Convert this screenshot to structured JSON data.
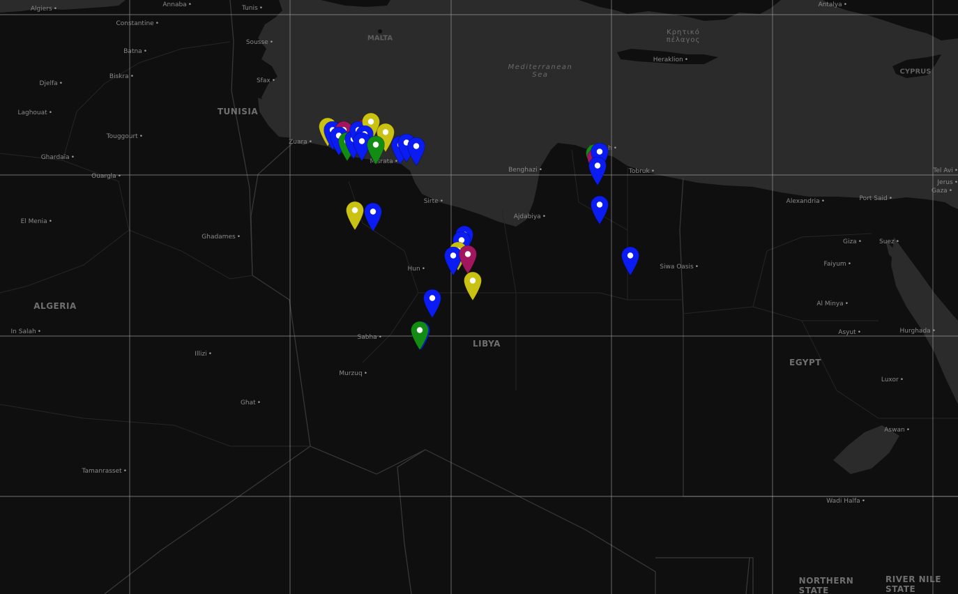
{
  "colors": {
    "land": "#0f0f0f",
    "sea": "#2b2b2b",
    "border": "#3a3a3a",
    "grid": "#bdbdbd",
    "marker_blue": "#0a1cf2",
    "marker_yellow": "#c9c213",
    "marker_green": "#138c13",
    "marker_magenta": "#a1165f",
    "marker_red": "#c41010"
  },
  "icons": {
    "marker": "map-pin-icon"
  },
  "labels": {
    "countries": [
      {
        "key": "tunisia",
        "text": "TUNISIA"
      },
      {
        "key": "algeria",
        "text": "ALGERIA"
      },
      {
        "key": "libya",
        "text": "LIBYA"
      },
      {
        "key": "egypt",
        "text": "EGYPT"
      },
      {
        "key": "cyprus",
        "text": "CYPRUS"
      },
      {
        "key": "northern-state",
        "text": "NORTHERN\nSTATE"
      },
      {
        "key": "river-nile-state",
        "text": "RIVER NILE\nSTATE"
      }
    ],
    "seas": [
      {
        "key": "mediterranean",
        "text": "Mediterranean\nSea"
      },
      {
        "key": "cretan",
        "text": "Κρητικό\nπέλαγος"
      },
      {
        "key": "malta",
        "text": "MALTA"
      }
    ],
    "cities": [
      {
        "key": "algiers",
        "text": "Algiers"
      },
      {
        "key": "annaba",
        "text": "Annaba"
      },
      {
        "key": "tunis",
        "text": "Tunis"
      },
      {
        "key": "constantine",
        "text": "Constantine"
      },
      {
        "key": "batna",
        "text": "Batna"
      },
      {
        "key": "sousse",
        "text": "Sousse"
      },
      {
        "key": "djelfa",
        "text": "Djelfa"
      },
      {
        "key": "biskra",
        "text": "Biskra"
      },
      {
        "key": "sfax",
        "text": "Sfax"
      },
      {
        "key": "laghouat",
        "text": "Laghouat"
      },
      {
        "key": "touggourt",
        "text": "Touggourt"
      },
      {
        "key": "ghardaia",
        "text": "Ghardaïa"
      },
      {
        "key": "ouargla",
        "text": "Ouargla"
      },
      {
        "key": "zuara",
        "text": "Zuara"
      },
      {
        "key": "misrata",
        "text": "Misrata"
      },
      {
        "key": "el-menia",
        "text": "El Menia"
      },
      {
        "key": "ghadames",
        "text": "Ghadames"
      },
      {
        "key": "sirte",
        "text": "Sirte"
      },
      {
        "key": "hun",
        "text": "Hun"
      },
      {
        "key": "in-salah",
        "text": "In Salah"
      },
      {
        "key": "sabha",
        "text": "Sabha"
      },
      {
        "key": "illizi",
        "text": "Illizi"
      },
      {
        "key": "murzuq",
        "text": "Murzuq"
      },
      {
        "key": "ghat",
        "text": "Ghat"
      },
      {
        "key": "tamanrasset",
        "text": "Tamanrasset"
      },
      {
        "key": "benghazi",
        "text": "Benghazi"
      },
      {
        "key": "ajdabiya",
        "text": "Ajdabiya"
      },
      {
        "key": "darnah",
        "text": "Darnah"
      },
      {
        "key": "tobruk",
        "text": "Tobruk"
      },
      {
        "key": "heraklion",
        "text": "Heraklion"
      },
      {
        "key": "antalya",
        "text": "Antalya"
      },
      {
        "key": "alexandria",
        "text": "Alexandria"
      },
      {
        "key": "port-said",
        "text": "Port Said"
      },
      {
        "key": "giza",
        "text": "Giza"
      },
      {
        "key": "suez",
        "text": "Suez"
      },
      {
        "key": "faiyum",
        "text": "Faiyum"
      },
      {
        "key": "siwa-oasis",
        "text": "Siwa Oasis"
      },
      {
        "key": "al-minya",
        "text": "Al Minya"
      },
      {
        "key": "asyut",
        "text": "Asyut"
      },
      {
        "key": "hurghada",
        "text": "Hurghada"
      },
      {
        "key": "luxor",
        "text": "Luxor"
      },
      {
        "key": "aswan",
        "text": "Aswan"
      },
      {
        "key": "wadi-halfa",
        "text": "Wadi Halfa"
      },
      {
        "key": "tel-aviv",
        "text": "Tel Avi"
      },
      {
        "key": "jerusalem",
        "text": "Jerus"
      },
      {
        "key": "gaza",
        "text": "Gaza"
      }
    ]
  },
  "markers": [
    {
      "color": "yellow",
      "lon": 11.6,
      "lat": 32.95
    },
    {
      "color": "blue",
      "lon": 11.75,
      "lat": 32.85
    },
    {
      "color": "magenta",
      "lon": 12.1,
      "lat": 32.85
    },
    {
      "color": "blue",
      "lon": 11.95,
      "lat": 32.7
    },
    {
      "color": "green",
      "lon": 12.2,
      "lat": 32.55
    },
    {
      "color": "blue",
      "lon": 12.4,
      "lat": 32.6
    },
    {
      "color": "red",
      "lon": 12.7,
      "lat": 32.9
    },
    {
      "color": "blue",
      "lon": 12.55,
      "lat": 32.85
    },
    {
      "color": "yellow",
      "lon": 12.95,
      "lat": 33.1
    },
    {
      "color": "blue",
      "lon": 12.75,
      "lat": 32.75
    },
    {
      "color": "blue",
      "lon": 12.65,
      "lat": 32.55
    },
    {
      "color": "yellow",
      "lon": 13.4,
      "lat": 32.8
    },
    {
      "color": "green",
      "lon": 13.1,
      "lat": 32.45
    },
    {
      "color": "blue",
      "lon": 13.85,
      "lat": 32.45
    },
    {
      "color": "blue",
      "lon": 14.05,
      "lat": 32.5
    },
    {
      "color": "blue",
      "lon": 14.35,
      "lat": 32.4
    },
    {
      "color": "green",
      "lon": 19.9,
      "lat": 32.2
    },
    {
      "color": "magenta",
      "lon": 19.95,
      "lat": 32.1
    },
    {
      "color": "blue",
      "lon": 20.05,
      "lat": 32.25
    },
    {
      "color": "blue",
      "lon": 20.0,
      "lat": 31.85
    },
    {
      "color": "blue",
      "lon": 20.05,
      "lat": 30.75
    },
    {
      "color": "yellow",
      "lon": 12.45,
      "lat": 30.6
    },
    {
      "color": "blue",
      "lon": 13.0,
      "lat": 30.55
    },
    {
      "color": "blue",
      "lon": 15.85,
      "lat": 29.9
    },
    {
      "color": "blue",
      "lon": 15.75,
      "lat": 29.75
    },
    {
      "color": "yellow",
      "lon": 15.65,
      "lat": 29.45
    },
    {
      "color": "blue",
      "lon": 15.5,
      "lat": 29.3
    },
    {
      "color": "magenta",
      "lon": 15.95,
      "lat": 29.35
    },
    {
      "color": "yellow",
      "lon": 16.1,
      "lat": 28.6
    },
    {
      "color": "blue",
      "lon": 14.85,
      "lat": 28.1
    },
    {
      "color": "blue",
      "lon": 14.5,
      "lat": 27.2
    },
    {
      "color": "green",
      "lon": 14.45,
      "lat": 27.2
    },
    {
      "color": "blue",
      "lon": 21.0,
      "lat": 29.3
    }
  ]
}
